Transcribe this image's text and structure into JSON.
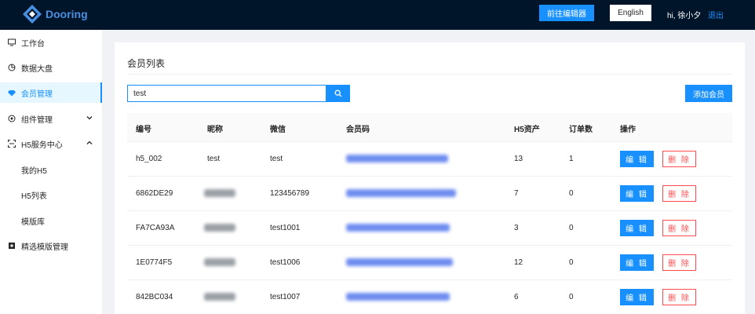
{
  "header": {
    "logo_text": "Dooring",
    "editor_button": "前往编辑器",
    "language_button": "English",
    "greeting": "hi, 徐小夕",
    "logout": "退出"
  },
  "sidebar": {
    "items": [
      {
        "label": "工作台",
        "icon": "desktop-icon"
      },
      {
        "label": "数据大盘",
        "icon": "pie-chart-icon"
      },
      {
        "label": "会员管理",
        "icon": "diamond-icon",
        "active": true
      },
      {
        "label": "组件管理",
        "icon": "block-icon",
        "expandable": "collapsed"
      },
      {
        "label": "H5服务中心",
        "icon": "scan-icon",
        "expandable": "expanded"
      },
      {
        "label": "精选模版管理",
        "icon": "template-icon"
      }
    ],
    "sub_items": [
      "我的H5",
      "H5列表",
      "模版库"
    ]
  },
  "main": {
    "title": "会员列表",
    "search_value": "test",
    "add_button": "添加会员",
    "columns": [
      "编号",
      "昵称",
      "微信",
      "会员码",
      "H5资产",
      "订单数",
      "操作"
    ],
    "rows": [
      {
        "id": "h5_002",
        "nickname": "test",
        "wechat": "test",
        "h5": "13",
        "orders": "1",
        "nick_blurred": false,
        "code_width": 130
      },
      {
        "id": "6862DE29",
        "nickname": "",
        "wechat": "123456789",
        "h5": "7",
        "orders": "0",
        "nick_blurred": true,
        "code_width": 140
      },
      {
        "id": "FA7CA93A",
        "nickname": "",
        "wechat": "test1001",
        "h5": "3",
        "orders": "0",
        "nick_blurred": true,
        "code_width": 132
      },
      {
        "id": "1E0774F5",
        "nickname": "",
        "wechat": "test1006",
        "h5": "12",
        "orders": "0",
        "nick_blurred": true,
        "code_width": 136
      },
      {
        "id": "842BC034",
        "nickname": "",
        "wechat": "test1007",
        "h5": "6",
        "orders": "0",
        "nick_blurred": true,
        "code_width": 132
      }
    ],
    "edit_label": "编 辑",
    "delete_label": "删 除"
  },
  "colors": {
    "header_bg": "#001529",
    "primary": "#1890ff",
    "danger": "#ff4d4f"
  }
}
